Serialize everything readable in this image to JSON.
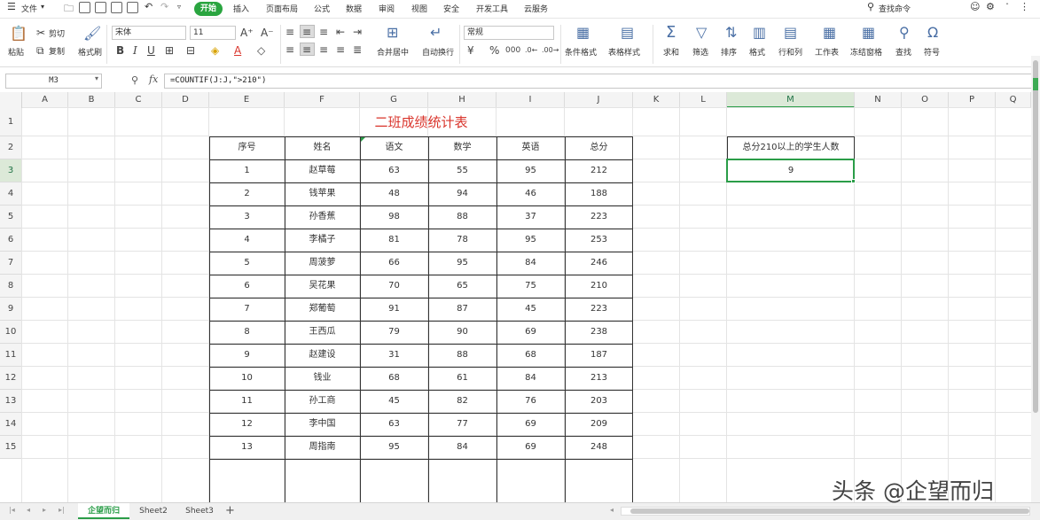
{
  "menubar": {
    "file": "文件",
    "tabs": [
      "开始",
      "插入",
      "页面布局",
      "公式",
      "数据",
      "审阅",
      "视图",
      "安全",
      "开发工具",
      "云服务"
    ],
    "search": "查找命令"
  },
  "ribbon": {
    "paste": "粘贴",
    "cut": "剪切",
    "copy": "复制",
    "format_painter": "格式刷",
    "font_name": "宋体",
    "font_size": "11",
    "merge_center": "合并居中",
    "wrap_text": "自动换行",
    "number_format": "常规",
    "conditional_format": "条件格式",
    "table_style": "表格样式",
    "sum": "求和",
    "filter": "筛选",
    "sort": "排序",
    "format": "格式",
    "row_col": "行和列",
    "worksheet": "工作表",
    "freeze": "冻结窗格",
    "find": "查找",
    "symbol": "符号"
  },
  "formula_bar": {
    "cell_ref": "M3",
    "fx": "fx",
    "formula": "=COUNTIF(J:J,\">210\")"
  },
  "columns": [
    "A",
    "B",
    "C",
    "D",
    "E",
    "F",
    "G",
    "H",
    "I",
    "J",
    "K",
    "L",
    "M",
    "N",
    "O",
    "P",
    "Q"
  ],
  "rows": [
    "1",
    "2",
    "3",
    "4",
    "5",
    "6",
    "7",
    "8",
    "9",
    "10",
    "11",
    "12",
    "13",
    "14",
    "15"
  ],
  "sheet": {
    "title": "二班成绩统计表",
    "headers": [
      "序号",
      "姓名",
      "语文",
      "数学",
      "英语",
      "总分"
    ],
    "data": [
      [
        "1",
        "赵草莓",
        "63",
        "55",
        "95",
        "212"
      ],
      [
        "2",
        "钱苹果",
        "48",
        "94",
        "46",
        "188"
      ],
      [
        "3",
        "孙香蕉",
        "98",
        "88",
        "37",
        "223"
      ],
      [
        "4",
        "李橘子",
        "81",
        "78",
        "95",
        "253"
      ],
      [
        "5",
        "周菠萝",
        "66",
        "95",
        "84",
        "246"
      ],
      [
        "6",
        "吴花果",
        "70",
        "65",
        "75",
        "210"
      ],
      [
        "7",
        "郑葡萄",
        "91",
        "87",
        "45",
        "223"
      ],
      [
        "8",
        "王西瓜",
        "79",
        "90",
        "69",
        "238"
      ],
      [
        "9",
        "赵建设",
        "31",
        "88",
        "68",
        "187"
      ],
      [
        "10",
        "钱业",
        "68",
        "61",
        "84",
        "213"
      ],
      [
        "11",
        "孙工商",
        "45",
        "82",
        "76",
        "203"
      ],
      [
        "12",
        "李中国",
        "63",
        "77",
        "69",
        "209"
      ],
      [
        "13",
        "周指南",
        "95",
        "84",
        "69",
        "248"
      ]
    ],
    "stat_label": "总分210以上的学生人数",
    "stat_value": "9"
  },
  "sheet_tabs": [
    "企望而归",
    "Sheet2",
    "Sheet3"
  ],
  "watermark": "头条 @企望而归",
  "colors": {
    "accent": "#2a9d48",
    "title": "#d9342b"
  }
}
